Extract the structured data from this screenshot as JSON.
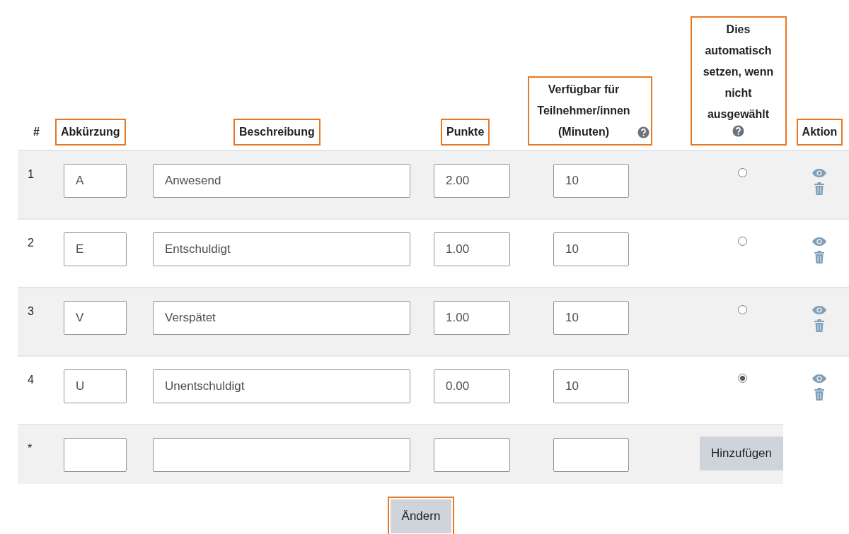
{
  "columns": [
    {
      "label": "#",
      "highlighted": false,
      "help": false
    },
    {
      "label": "Abkürzung",
      "highlighted": true,
      "help": false
    },
    {
      "label": "Beschreibung",
      "highlighted": true,
      "help": false
    },
    {
      "label": "Punkte",
      "highlighted": true,
      "help": false
    },
    {
      "label": "Verfügbar für Teilnehmer/innen (Minuten)",
      "highlighted": true,
      "help": true
    },
    {
      "label": "Dies automatisch setzen, wenn nicht ausgewählt",
      "highlighted": true,
      "help": true
    },
    {
      "label": "Aktion",
      "highlighted": true,
      "help": false
    }
  ],
  "rows": [
    {
      "number": "1",
      "abbreviation": "A",
      "description": "Anwesend",
      "points": "2.00",
      "minutes": "10",
      "auto_set": false
    },
    {
      "number": "2",
      "abbreviation": "E",
      "description": "Entschuldigt",
      "points": "1.00",
      "minutes": "10",
      "auto_set": false
    },
    {
      "number": "3",
      "abbreviation": "V",
      "description": "Verspätet",
      "points": "1.00",
      "minutes": "10",
      "auto_set": false
    },
    {
      "number": "4",
      "abbreviation": "U",
      "description": "Unentschuldigt",
      "points": "0.00",
      "minutes": "10",
      "auto_set": true
    }
  ],
  "new_row": {
    "marker": "*",
    "button": "Hinzufügen"
  },
  "submit": {
    "label": "Ändern",
    "highlighted": true
  }
}
